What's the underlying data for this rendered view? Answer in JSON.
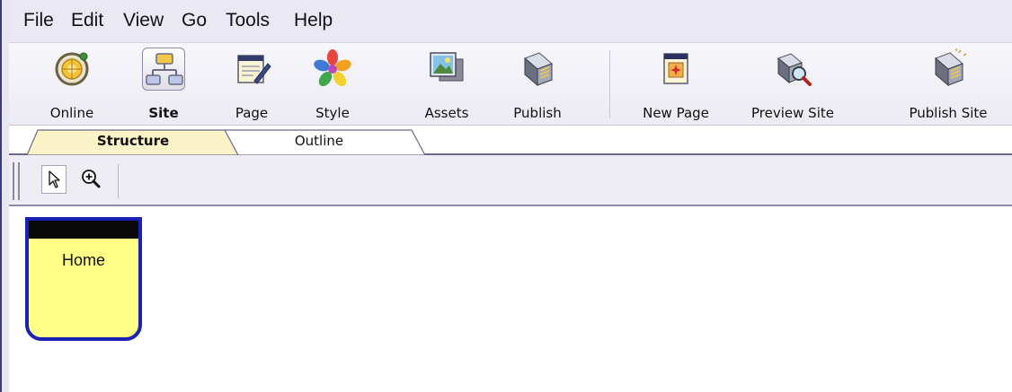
{
  "menu": {
    "items": [
      {
        "label": "File"
      },
      {
        "label": "Edit"
      },
      {
        "label": "View"
      },
      {
        "label": "Go"
      },
      {
        "label": "Tools"
      },
      {
        "label": "Help"
      }
    ]
  },
  "toolbar": {
    "buttons": [
      {
        "label": "Online",
        "icon": "globe-icon"
      },
      {
        "label": "Site",
        "icon": "sitemap-icon",
        "selected": true
      },
      {
        "label": "Page",
        "icon": "notepad-icon"
      },
      {
        "label": "Style",
        "icon": "color-wheel-icon"
      },
      {
        "label": "Assets",
        "icon": "image-stack-icon"
      },
      {
        "label": "Publish",
        "icon": "page-stack-icon"
      },
      {
        "label": "New Page",
        "icon": "new-page-icon"
      },
      {
        "label": "Preview Site",
        "icon": "magnifier-pages-icon"
      },
      {
        "label": "Publish Site",
        "icon": "publish-stack-icon"
      }
    ]
  },
  "tabs": [
    {
      "label": "Structure",
      "active": true
    },
    {
      "label": "Outline",
      "active": false
    }
  ],
  "view_tools": [
    {
      "icon": "pointer-arrow-icon",
      "pressed": true
    },
    {
      "icon": "zoom-in-icon",
      "pressed": false
    }
  ],
  "canvas": {
    "pages": [
      {
        "title": "Home"
      }
    ]
  },
  "colors": {
    "menu_bg": "#eae8f3",
    "toolbar_bg": "#f2f1f7",
    "active_tab": "#fbf3c8",
    "node_fill": "#ffff88",
    "node_border": "#1a22b4"
  }
}
